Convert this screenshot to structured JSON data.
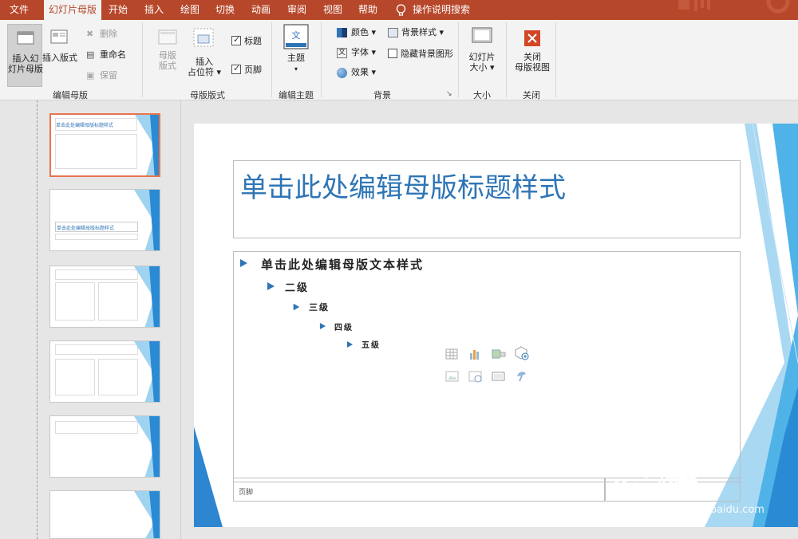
{
  "tabs": [
    "文件",
    "幻灯片母版",
    "开始",
    "插入",
    "绘图",
    "切换",
    "动画",
    "审阅",
    "视图",
    "帮助"
  ],
  "search_hint": "操作说明搜索",
  "ribbon": {
    "edit_master": {
      "insert_slide_master": "插入幻\n灯片母版",
      "insert_layout": "插入版式",
      "delete": "删除",
      "rename": "重命名",
      "preserve": "保留",
      "label": "编辑母版"
    },
    "master_layout": {
      "master_layout_btn": "母版\n版式",
      "insert_placeholder": "插入\n占位符 ▾",
      "title_check": "标题",
      "footer_check": "页脚",
      "label": "母版版式"
    },
    "edit_theme": {
      "themes": "主题",
      "themes_arrow": "▾",
      "label": "编辑主题"
    },
    "background": {
      "colors": "颜色 ▾",
      "fonts": "字体 ▾",
      "effects": "效果 ▾",
      "bg_styles": "背景样式 ▾",
      "hide_bg": "隐藏背景图形",
      "label": "背景"
    },
    "size": {
      "slide_size": "幻灯片\n大小 ▾",
      "label": "大小"
    },
    "close": {
      "close_master": "关闭\n母版视图",
      "label": "关闭"
    }
  },
  "slide": {
    "title": "单击此处编辑母版标题样式",
    "levels": [
      "单击此处编辑母版文本样式",
      "二级",
      "三级",
      "四级",
      "五级"
    ],
    "footer": "页脚"
  },
  "thumbs": {
    "master_title": "单击此处编辑母版标题样式",
    "title_layout": "单击此处编辑母版标题样式"
  },
  "watermark": {
    "brand": "Bai 经验",
    "url": "jingyan.baidu.com"
  },
  "colors": {
    "accent": "#b7472a",
    "blue": "#2e75b6",
    "selection": "#e8744f"
  }
}
